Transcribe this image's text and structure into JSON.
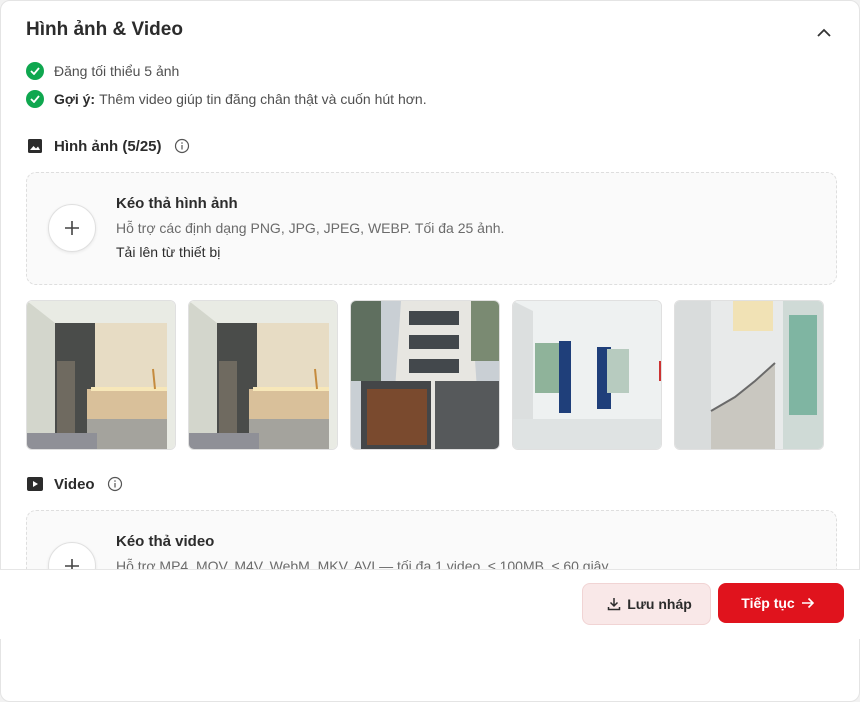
{
  "section": {
    "title": "Hình ảnh & Video"
  },
  "requirements": [
    {
      "bold": "",
      "text": "Đăng tối thiểu 5 ảnh"
    },
    {
      "bold": "Gợi ý:",
      "text": "Thêm video giúp tin đăng chân thật và cuốn hút hơn."
    }
  ],
  "images": {
    "title": "Hình ảnh (5/25)",
    "drop_title": "Kéo thả hình ảnh",
    "drop_hint": "Hỗ trợ các định dạng PNG, JPG, JPEG, WEBP. Tối đa 25 ảnh.",
    "upload_link": "Tải lên từ thiết bị",
    "thumbnails": [
      "hallway-interior",
      "hallway-interior",
      "building-exterior",
      "empty-room-blue-curtains",
      "staircase"
    ]
  },
  "video": {
    "title": "Video",
    "drop_title": "Kéo thả video",
    "drop_hint": "Hỗ trợ MP4, MOV, M4V, WebM, MKV, AVI — tối đa 1 video, ≤ 100MB, ≤ 60 giây."
  },
  "footer": {
    "save_draft": "Lưu nháp",
    "next": "Tiếp tục"
  },
  "colors": {
    "accent": "#e0131d",
    "success": "#0fa74f",
    "draft_bg": "#f9e8e8"
  }
}
